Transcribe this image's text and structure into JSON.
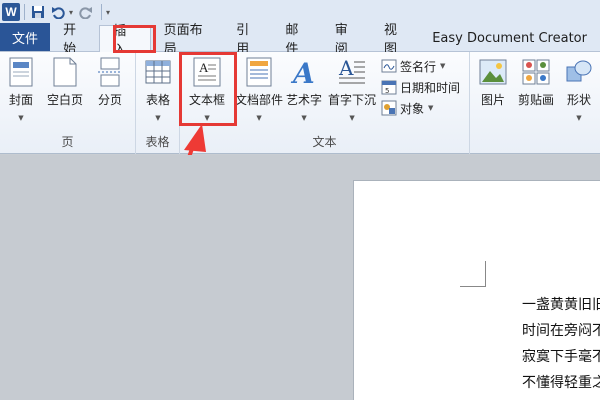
{
  "app_icon": "W",
  "qat": {
    "icons": [
      "save-icon",
      "undo-icon",
      "redo-icon",
      "customize-icon"
    ]
  },
  "tabs": {
    "file": "文件",
    "home": "开始",
    "insert": "插入",
    "layout": "页面布局",
    "references": "引用",
    "mailings": "邮件",
    "review": "审阅",
    "view": "视图",
    "addin": "Easy Document Creator"
  },
  "ribbon": {
    "pages": {
      "label": "页",
      "cover": "封面",
      "blank": "空白页",
      "break": "分页"
    },
    "tables": {
      "label": "表格",
      "table": "表格"
    },
    "text": {
      "label": "文本",
      "textbox": "文本框",
      "quickparts": "文档部件",
      "wordart": "艺术字",
      "dropcap": "首字下沉",
      "signature": "签名行",
      "datetime": "日期和时间",
      "object": "对象"
    },
    "illustrations": {
      "picture": "图片",
      "clipart": "剪贴画",
      "shapes": "形状"
    }
  },
  "document": {
    "lines": [
      "一盏黄黄旧旧",
      "时间在旁闷不",
      "寂寞下手毫不",
      "不懂得轻重之"
    ]
  },
  "colors": {
    "accent": "#2a5597",
    "highlight": "#e53935"
  }
}
